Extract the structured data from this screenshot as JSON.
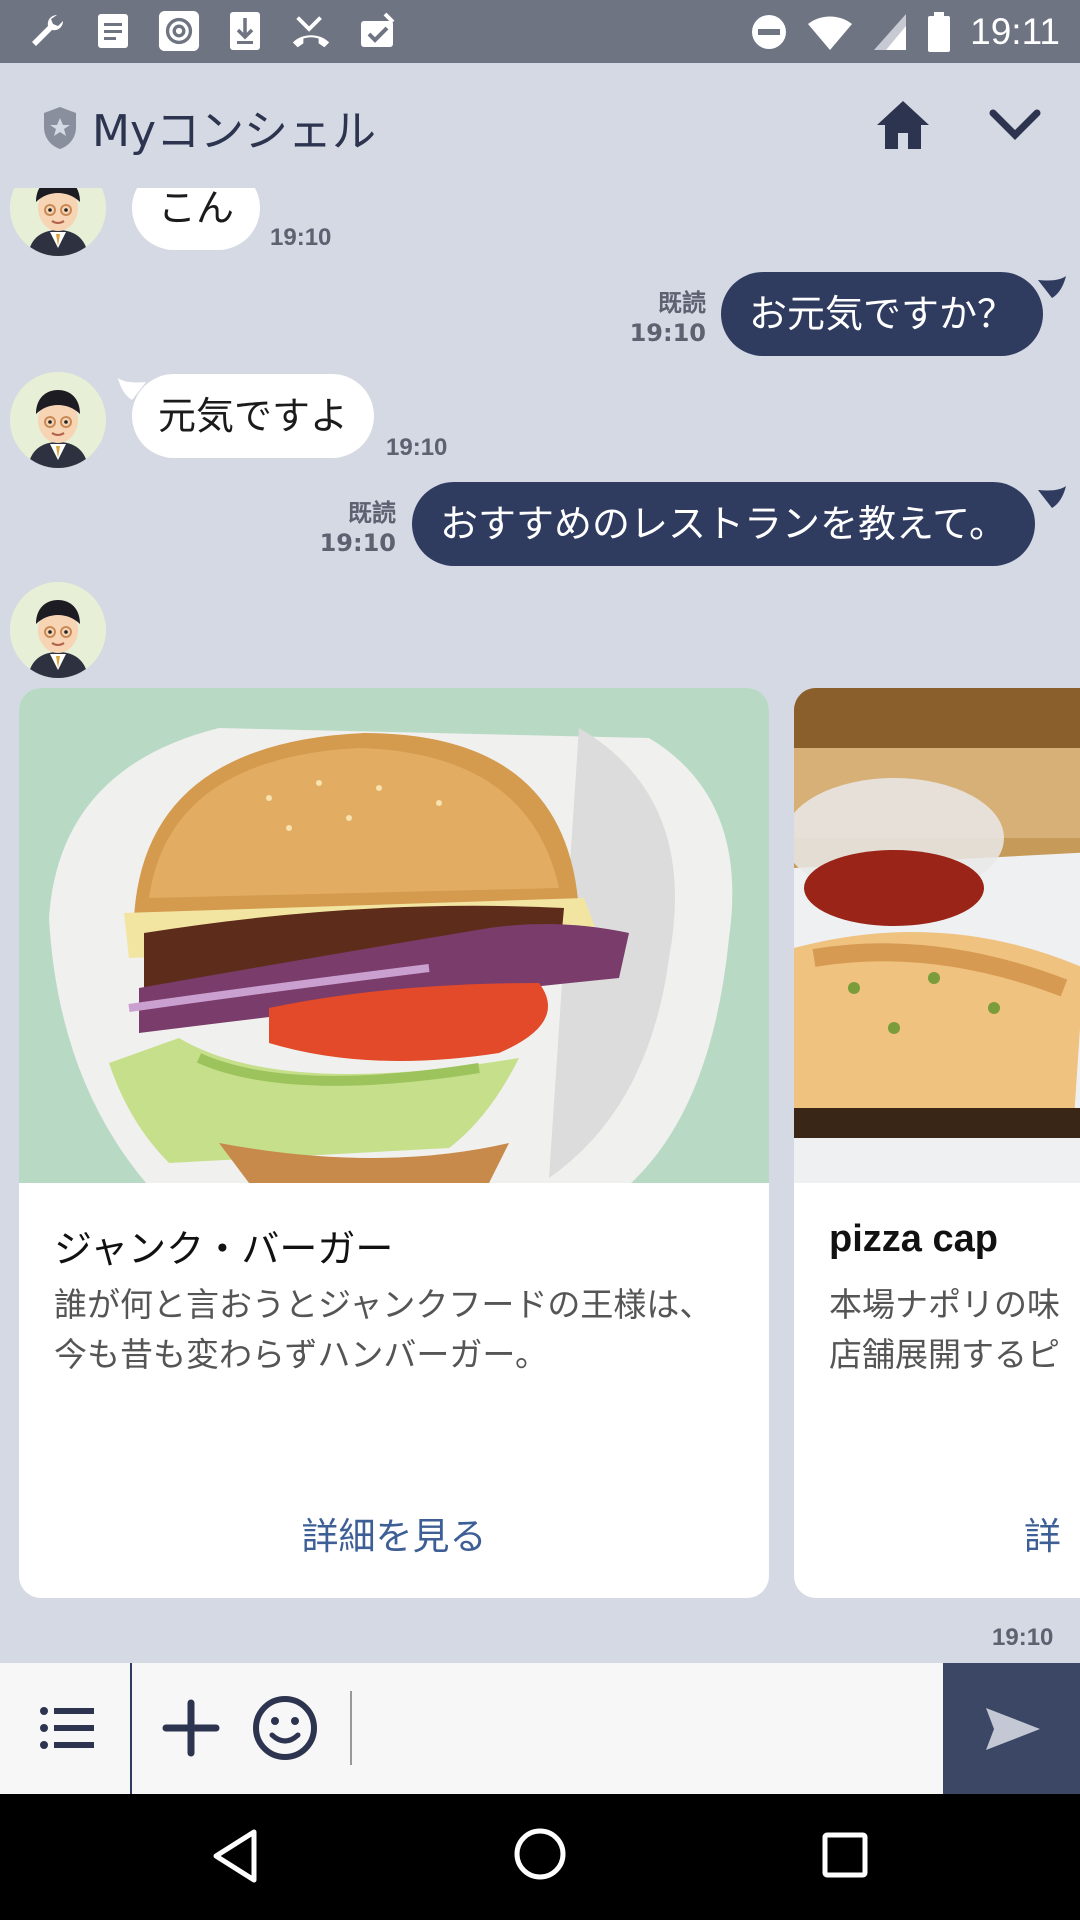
{
  "status_bar": {
    "time": "19:11",
    "left_icons": [
      "wrench-icon",
      "note-icon",
      "at-icon",
      "download-icon",
      "missed-call-icon",
      "clipboard-check-icon"
    ],
    "right_icons": [
      "do-not-disturb-icon",
      "wifi-icon",
      "signal-icon",
      "battery-icon"
    ]
  },
  "header": {
    "title": "Myコンシェル",
    "home_icon": "home-icon",
    "collapse_icon": "chevron-down-icon"
  },
  "messages": [
    {
      "side": "in",
      "text": "こん",
      "time": "19:10"
    },
    {
      "side": "out",
      "text": "お元気ですか？",
      "read": "既読",
      "time": "19:10"
    },
    {
      "side": "in",
      "text": "元気ですよ",
      "time": "19:10"
    },
    {
      "side": "out",
      "text": "おすすめのレストランを教えて。",
      "read": "既読",
      "time": "19:10"
    }
  ],
  "carousel": {
    "time": "19:10",
    "cards": [
      {
        "title": "ジャンク・バーガー",
        "description": "誰が何と言おうとジャンクフードの王様は、今も昔も変わらずハンバーガー。",
        "link": "詳細を見る"
      },
      {
        "title": "pizza cap",
        "description": "本場ナポリの味\n店舗展開するピ",
        "link": "詳"
      }
    ]
  },
  "input_bar": {
    "menu_icon": "menu-list-icon",
    "plus_icon": "plus-icon",
    "emoji_icon": "emoji-icon",
    "placeholder": "",
    "send_icon": "send-icon"
  },
  "nav_bar": {
    "icons": [
      "back-icon",
      "home-circle-icon",
      "recents-icon"
    ]
  }
}
